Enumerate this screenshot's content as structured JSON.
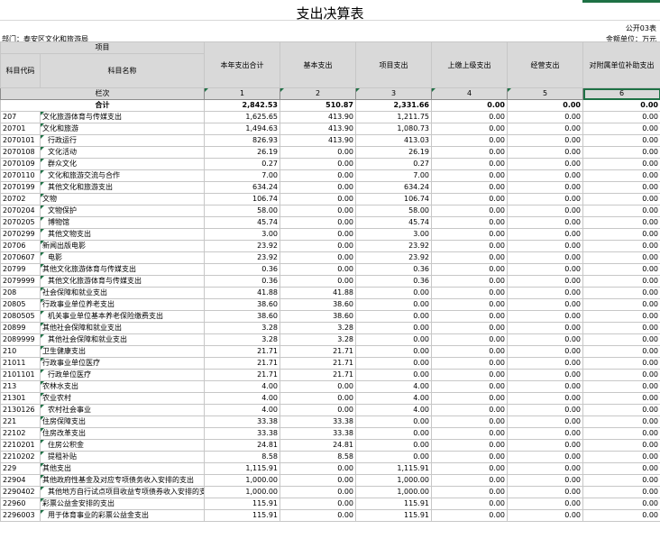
{
  "title": "支出决算表",
  "code": "公开03表",
  "department": "部门：泰安区文化和旅游局",
  "unit": "金额单位：万元",
  "header": {
    "project": "项目",
    "code_col": "科目代码",
    "name_col": "科目名称",
    "cols": [
      "本年支出合计",
      "基本支出",
      "项目支出",
      "上缴上级支出",
      "经营支出",
      "对附属单位补助支出"
    ]
  },
  "lanci": {
    "label": "栏次",
    "nums": [
      "1",
      "2",
      "3",
      "4",
      "5",
      "6"
    ]
  },
  "total": {
    "label": "合计",
    "values": [
      "2,842.53",
      "510.87",
      "2,331.66",
      "0.00",
      "0.00",
      "0.00"
    ]
  },
  "rows": [
    {
      "code": "207",
      "name": "文化旅游体育与传媒支出",
      "v": [
        "1,625.65",
        "413.90",
        "1,211.75",
        "0.00",
        "0.00",
        "0.00"
      ]
    },
    {
      "code": "20701",
      "name": "文化和旅游",
      "v": [
        "1,494.63",
        "413.90",
        "1,080.73",
        "0.00",
        "0.00",
        "0.00"
      ]
    },
    {
      "code": "2070101",
      "name": "行政运行",
      "v": [
        "826.93",
        "413.90",
        "413.03",
        "0.00",
        "0.00",
        "0.00"
      ],
      "indent": true
    },
    {
      "code": "2070108",
      "name": "文化活动",
      "v": [
        "26.19",
        "0.00",
        "26.19",
        "0.00",
        "0.00",
        "0.00"
      ],
      "indent": true
    },
    {
      "code": "2070109",
      "name": "群众文化",
      "v": [
        "0.27",
        "0.00",
        "0.27",
        "0.00",
        "0.00",
        "0.00"
      ],
      "indent": true
    },
    {
      "code": "2070110",
      "name": "文化和旅游交流与合作",
      "v": [
        "7.00",
        "0.00",
        "7.00",
        "0.00",
        "0.00",
        "0.00"
      ],
      "indent": true
    },
    {
      "code": "2070199",
      "name": "其他文化和旅游支出",
      "v": [
        "634.24",
        "0.00",
        "634.24",
        "0.00",
        "0.00",
        "0.00"
      ],
      "indent": true
    },
    {
      "code": "20702",
      "name": "文物",
      "v": [
        "106.74",
        "0.00",
        "106.74",
        "0.00",
        "0.00",
        "0.00"
      ]
    },
    {
      "code": "2070204",
      "name": "文物保护",
      "v": [
        "58.00",
        "0.00",
        "58.00",
        "0.00",
        "0.00",
        "0.00"
      ],
      "indent": true
    },
    {
      "code": "2070205",
      "name": "博物馆",
      "v": [
        "45.74",
        "0.00",
        "45.74",
        "0.00",
        "0.00",
        "0.00"
      ],
      "indent": true
    },
    {
      "code": "2070299",
      "name": "其他文物支出",
      "v": [
        "3.00",
        "0.00",
        "3.00",
        "0.00",
        "0.00",
        "0.00"
      ],
      "indent": true
    },
    {
      "code": "20706",
      "name": "新闻出版电影",
      "v": [
        "23.92",
        "0.00",
        "23.92",
        "0.00",
        "0.00",
        "0.00"
      ]
    },
    {
      "code": "2070607",
      "name": "电影",
      "v": [
        "23.92",
        "0.00",
        "23.92",
        "0.00",
        "0.00",
        "0.00"
      ],
      "indent": true
    },
    {
      "code": "20799",
      "name": "其他文化旅游体育与传媒支出",
      "v": [
        "0.36",
        "0.00",
        "0.36",
        "0.00",
        "0.00",
        "0.00"
      ]
    },
    {
      "code": "2079999",
      "name": "其他文化旅游体育与传媒支出",
      "v": [
        "0.36",
        "0.00",
        "0.36",
        "0.00",
        "0.00",
        "0.00"
      ],
      "indent": true
    },
    {
      "code": "208",
      "name": "社会保障和就业支出",
      "v": [
        "41.88",
        "41.88",
        "0.00",
        "0.00",
        "0.00",
        "0.00"
      ]
    },
    {
      "code": "20805",
      "name": "行政事业单位养老支出",
      "v": [
        "38.60",
        "38.60",
        "0.00",
        "0.00",
        "0.00",
        "0.00"
      ]
    },
    {
      "code": "2080505",
      "name": "机关事业单位基本养老保险缴费支出",
      "v": [
        "38.60",
        "38.60",
        "0.00",
        "0.00",
        "0.00",
        "0.00"
      ],
      "indent": true
    },
    {
      "code": "20899",
      "name": "其他社会保障和就业支出",
      "v": [
        "3.28",
        "3.28",
        "0.00",
        "0.00",
        "0.00",
        "0.00"
      ]
    },
    {
      "code": "2089999",
      "name": "其他社会保障和就业支出",
      "v": [
        "3.28",
        "3.28",
        "0.00",
        "0.00",
        "0.00",
        "0.00"
      ],
      "indent": true
    },
    {
      "code": "210",
      "name": "卫生健康支出",
      "v": [
        "21.71",
        "21.71",
        "0.00",
        "0.00",
        "0.00",
        "0.00"
      ]
    },
    {
      "code": "21011",
      "name": "行政事业单位医疗",
      "v": [
        "21.71",
        "21.71",
        "0.00",
        "0.00",
        "0.00",
        "0.00"
      ]
    },
    {
      "code": "2101101",
      "name": "行政单位医疗",
      "v": [
        "21.71",
        "21.71",
        "0.00",
        "0.00",
        "0.00",
        "0.00"
      ],
      "indent": true
    },
    {
      "code": "213",
      "name": "农林水支出",
      "v": [
        "4.00",
        "0.00",
        "4.00",
        "0.00",
        "0.00",
        "0.00"
      ]
    },
    {
      "code": "21301",
      "name": "农业农村",
      "v": [
        "4.00",
        "0.00",
        "4.00",
        "0.00",
        "0.00",
        "0.00"
      ]
    },
    {
      "code": "2130126",
      "name": "农村社会事业",
      "v": [
        "4.00",
        "0.00",
        "4.00",
        "0.00",
        "0.00",
        "0.00"
      ],
      "indent": true
    },
    {
      "code": "221",
      "name": "住房保障支出",
      "v": [
        "33.38",
        "33.38",
        "0.00",
        "0.00",
        "0.00",
        "0.00"
      ]
    },
    {
      "code": "22102",
      "name": "住房改革支出",
      "v": [
        "33.38",
        "33.38",
        "0.00",
        "0.00",
        "0.00",
        "0.00"
      ]
    },
    {
      "code": "2210201",
      "name": "住房公积金",
      "v": [
        "24.81",
        "24.81",
        "0.00",
        "0.00",
        "0.00",
        "0.00"
      ],
      "indent": true
    },
    {
      "code": "2210202",
      "name": "提租补贴",
      "v": [
        "8.58",
        "8.58",
        "0.00",
        "0.00",
        "0.00",
        "0.00"
      ],
      "indent": true
    },
    {
      "code": "229",
      "name": "其他支出",
      "v": [
        "1,115.91",
        "0.00",
        "1,115.91",
        "0.00",
        "0.00",
        "0.00"
      ]
    },
    {
      "code": "22904",
      "name": "其他政府性基金及对应专项债务收入安排的支出",
      "v": [
        "1,000.00",
        "0.00",
        "1,000.00",
        "0.00",
        "0.00",
        "0.00"
      ]
    },
    {
      "code": "2290402",
      "name": "其他地方自行试点项目收益专项债券收入安排的支出",
      "v": [
        "1,000.00",
        "0.00",
        "1,000.00",
        "0.00",
        "0.00",
        "0.00"
      ],
      "small": true
    },
    {
      "code": "22960",
      "name": "彩票公益金安排的支出",
      "v": [
        "115.91",
        "0.00",
        "115.91",
        "0.00",
        "0.00",
        "0.00"
      ]
    },
    {
      "code": "2296003",
      "name": "用于体育事业的彩票公益金支出",
      "v": [
        "115.91",
        "0.00",
        "115.91",
        "0.00",
        "0.00",
        "0.00"
      ],
      "indent": true
    }
  ]
}
